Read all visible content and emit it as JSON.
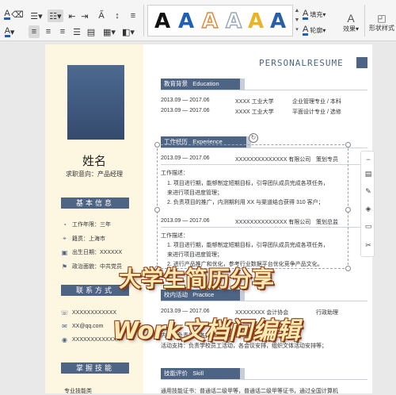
{
  "ribbon": {
    "style_glyph": "A",
    "style_colors": [
      "#111111",
      "#1f5fb5",
      "#e08a3c",
      "#9aa7b8",
      "#e8b52a",
      "#2a5fa8"
    ],
    "fill_label": "填充",
    "outline_label": "轮廓",
    "effect_label": "效果",
    "text_style_label": "形状样式"
  },
  "resume": {
    "title": "PERSONALRESUME",
    "name": "姓名",
    "intent": "求职意向：产品经理",
    "basic_info_title": "基本信息",
    "basic_info": [
      {
        "icon": "clock-icon",
        "text": "工作年限：三年"
      },
      {
        "icon": "location-icon",
        "text": "籍贯：上海市"
      },
      {
        "icon": "calendar-icon",
        "text": "出生日期：XXXXXX"
      },
      {
        "icon": "flag-icon",
        "text": "政治面貌：中共党员"
      }
    ],
    "contact_title": "联系方式",
    "contact": [
      {
        "icon": "phone-icon",
        "text": "XXXXXXXXXXXX"
      },
      {
        "icon": "mail-icon",
        "text": "XX@qq.com"
      },
      {
        "icon": "wechat-icon",
        "text": "XXXXXXXXXXXXX"
      }
    ],
    "skills_title": "掌握技能",
    "skills_first": "专业技能类",
    "education": {
      "title": "教育背景",
      "subtitle": "Education",
      "rows": [
        {
          "date": "2013.09 — 2017.06",
          "school": "XXXX 工业大学",
          "major": "企业管理专业 / 本科"
        },
        {
          "date": "2013.09 — 2017.06",
          "school": "XXXX 工业大学",
          "major": "平面设计专业 / 选修"
        }
      ]
    },
    "experience": {
      "title": "工作经历",
      "subtitle": "Experience",
      "jobs": [
        {
          "date": "2013.09 — 2017.06",
          "company": "XXXXXXXXXXXXXX 有限公司",
          "role": "策划专员",
          "desc_label": "工作描述：",
          "items": [
            "1. 项目进行期，能够制定短期目标，引导团队成员完成各项任务，",
            "   来进行项目进度管理；",
            "2. 负责项目的推广，内测期利用 XX 与渠道结合获得 310 客户；"
          ]
        },
        {
          "date": "2013.09 — 2017.06",
          "company": "XXXXXXXXXXXXXX 有限公司",
          "role": "策划总监",
          "desc_label": "工作描述：",
          "items": [
            "1. 项目进行期，能够制定短期目标，引导团队成员完成各项任务，",
            "   来进行项目进度管理；",
            "2. 进行产品推广和优化，参考行业数据平台优化竞争产品文化。"
          ]
        }
      ]
    },
    "campus": {
      "title": "校内活动",
      "subtitle": "Practice",
      "date": "2013.09 — 2017.06",
      "org": "XXXXXXXX 会计协会",
      "role": "行政助理",
      "lines": [
        "内容：负责社团各类文件、文件、快递等；",
        "活动支持：负责学校员工活动，各会议安排，组织文体活动安排等；"
      ]
    },
    "skills": {
      "title": "技能评价",
      "subtitle": "Skill",
      "line": "通用技能证书：普通话二级甲等，普通话二级甲等证书，通过全国计算机"
    }
  },
  "overlay": {
    "line1": "大学生简历分享",
    "line2": "Work文档问编辑"
  }
}
